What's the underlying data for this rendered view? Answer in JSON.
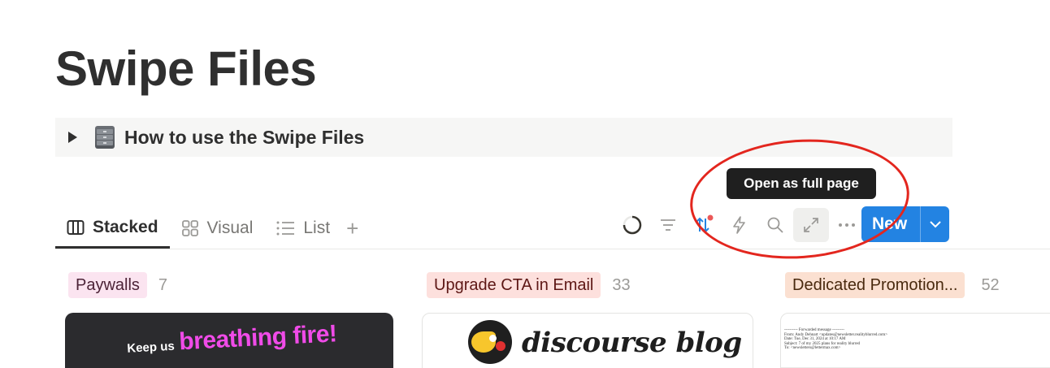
{
  "page": {
    "title": "Swipe Files"
  },
  "toggle": {
    "icon": "file-cabinet-icon",
    "label": "How to use the Swipe Files"
  },
  "tooltip": {
    "text": "Open as full page"
  },
  "tabs": [
    {
      "label": "Stacked",
      "icon": "columns-icon",
      "active": true
    },
    {
      "label": "Visual",
      "icon": "gallery-icon",
      "active": false
    },
    {
      "label": "List",
      "icon": "list-icon",
      "active": false
    }
  ],
  "toolbar": {
    "icons": [
      "loading-spinner-icon",
      "filter-icon",
      "sort-icon",
      "automation-bolt-icon",
      "search-icon",
      "open-full-page-icon",
      "more-options-icon"
    ],
    "new_label": "New"
  },
  "groups": [
    {
      "tag": "Paywalls",
      "count": "7",
      "tag_bg": "#fbe4f0",
      "tag_color": "#4c2337"
    },
    {
      "tag": "Upgrade CTA in Email",
      "count": "33",
      "tag_bg": "#fde0dd",
      "tag_color": "#5d1715"
    },
    {
      "tag": "Dedicated Promotion...",
      "count": "52",
      "tag_bg": "#fbe0d1",
      "tag_color": "#49290e"
    }
  ],
  "cards": {
    "paywall": {
      "prefix": "Keep us",
      "headline": "breathing fire!"
    },
    "upgrade": {
      "brand": "discourse blog"
    },
    "promotion": {
      "line1": "---------- Forwarded message ---------",
      "line2": "From: Andy Dehnart <updates@newsletter.realityblurred.com>",
      "line3": "Date: Tue, Dec 31, 2024 at 10:17 AM",
      "line4": "Subject: 7 of my 2025 plans for reality blurred",
      "line5": "To: <newsletters@lettermax.com>"
    }
  },
  "colors": {
    "accent": "#2383e2",
    "annotation": "#e3261e",
    "sort_dot": "#eb5757"
  }
}
